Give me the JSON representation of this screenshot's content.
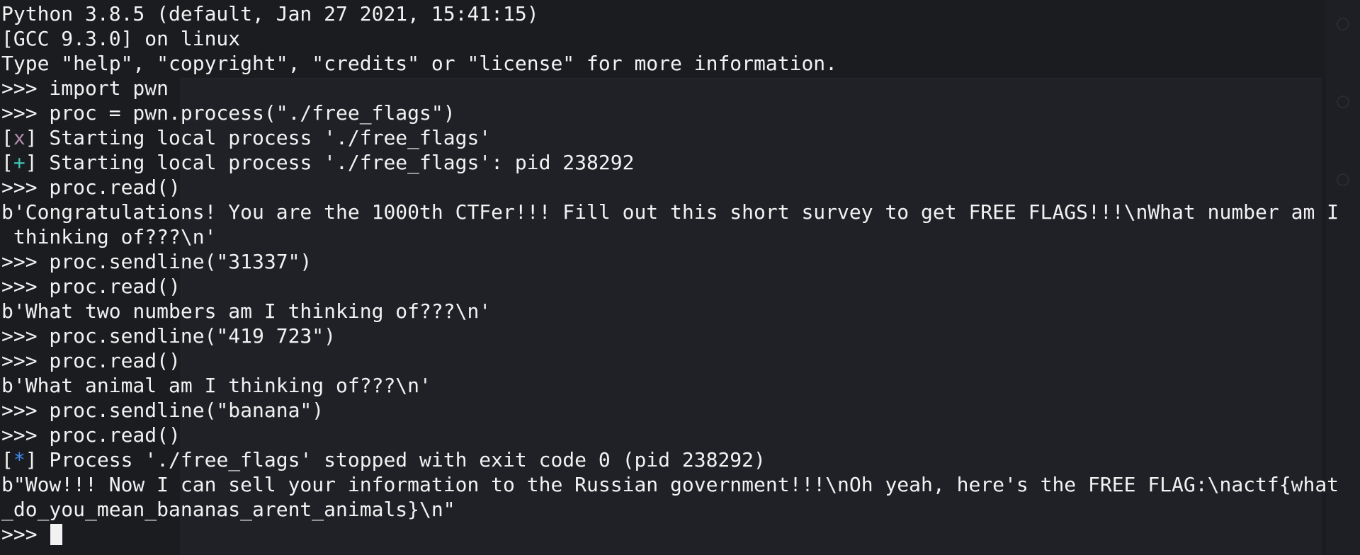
{
  "terminal": {
    "lines": [
      "Python 3.8.5 (default, Jan 27 2021, 15:41:15)",
      "[GCC 9.3.0] on linux",
      "Type \"help\", \"copyright\", \"credits\" or \"license\" for more information.",
      ">>> import pwn",
      ">>> proc = pwn.process(\"./free_flags\")"
    ],
    "status_starting": {
      "open": "[",
      "mark": "x",
      "close": "]",
      "text": " Starting local process './free_flags'"
    },
    "status_started": {
      "open": "[",
      "mark": "+",
      "close": "]",
      "text": " Starting local process './free_flags': pid 238292"
    },
    "lines2": [
      ">>> proc.read()",
      "b'Congratulations! You are the 1000th CTFer!!! Fill out this short survey to get FREE FLAGS!!!\\nWhat number am I",
      " thinking of???\\n'",
      ">>> proc.sendline(\"31337\")",
      ">>> proc.read()",
      "b'What two numbers am I thinking of???\\n'",
      ">>> proc.sendline(\"419 723\")",
      ">>> proc.read()",
      "b'What animal am I thinking of???\\n'",
      ">>> proc.sendline(\"banana\")",
      ">>> proc.read()"
    ],
    "status_stopped": {
      "open": "[",
      "mark": "*",
      "close": "]",
      "text": " Process './free_flags' stopped with exit code 0 (pid 238292)"
    },
    "lines3": [
      "b\"Wow!!! Now I can sell your information to the Russian government!!!\\nOh yeah, here's the FREE FLAG:\\nactf{what",
      "_do_you_mean_bananas_arent_animals}\\n\""
    ],
    "prompt": ">>> "
  },
  "colors": {
    "background": "#1b1c20",
    "foreground": "#f2f2f2",
    "mark_x": "#b48ead",
    "mark_plus": "#3ec9b5",
    "mark_star": "#3d8cf0"
  }
}
